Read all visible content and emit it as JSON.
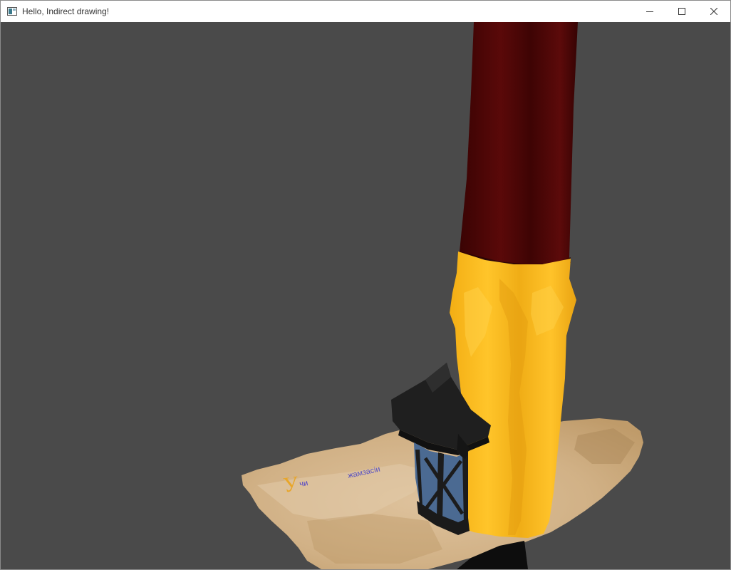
{
  "window": {
    "title": "Hello, Indirect drawing!",
    "controls": {
      "minimize_icon": "minimize-icon",
      "maximize_icon": "maximize-icon",
      "close_icon": "close-icon"
    }
  },
  "viewport": {
    "background_color": "#4a4a4a",
    "scene_objects": [
      "candle",
      "lantern",
      "parchment-map"
    ],
    "map_text": {
      "capital_letter": "У",
      "word_1": "чи",
      "word_2": "жамзасіи"
    }
  },
  "colors": {
    "candle_wax_top": "#4a0606",
    "candle_body": "#ffbf1e",
    "lantern_frame": "#222222",
    "lantern_glass": "#4b6a92",
    "parchment": "#d6b88f"
  }
}
